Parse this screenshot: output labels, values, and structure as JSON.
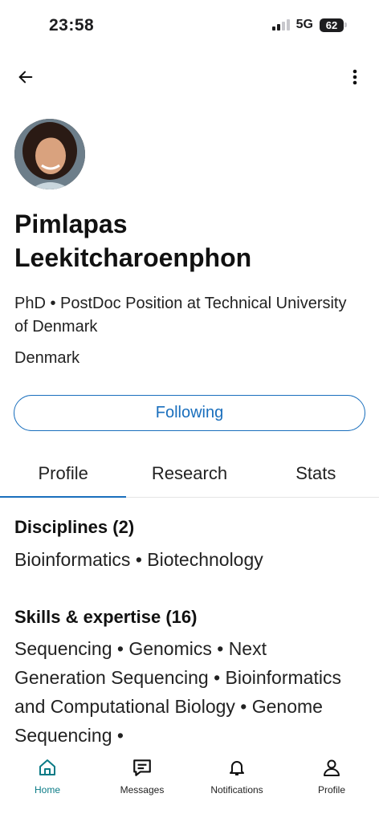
{
  "status_bar": {
    "time": "23:58",
    "network": "5G",
    "battery": "62"
  },
  "profile": {
    "name": "Pimlapas Leekitcharoenphon",
    "headline": "PhD • PostDoc Position at Technical University of Denmark",
    "location": "Denmark",
    "follow_label": "Following"
  },
  "tabs": [
    {
      "label": "Profile",
      "active": true
    },
    {
      "label": "Research",
      "active": false
    },
    {
      "label": "Stats",
      "active": false
    }
  ],
  "disciplines": {
    "title": "Disciplines (2)",
    "items": "Bioinformatics • Biotechnology"
  },
  "skills": {
    "title": "Skills & expertise (16)",
    "items": "Sequencing • Genomics • Next Generation Sequencing • Bioinformatics and Computational Biology • Genome Sequencing •"
  },
  "bottom_nav": [
    {
      "label": "Home",
      "icon": "home-icon",
      "active": true
    },
    {
      "label": "Messages",
      "icon": "messages-icon",
      "active": false
    },
    {
      "label": "Notifications",
      "icon": "bell-icon",
      "active": false
    },
    {
      "label": "Profile",
      "icon": "person-icon",
      "active": false
    }
  ],
  "colors": {
    "accent": "#1a6fbd",
    "nav_active": "#0a7b86"
  }
}
